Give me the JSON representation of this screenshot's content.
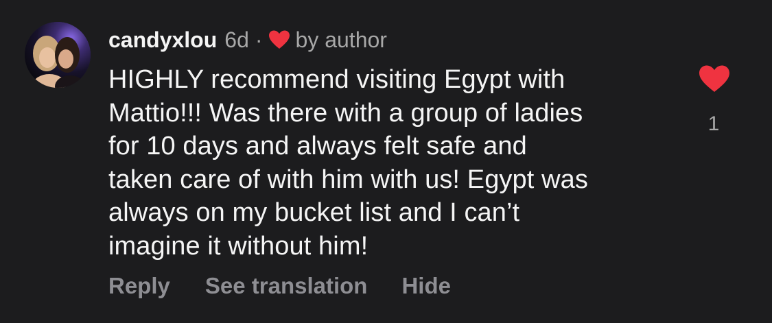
{
  "comment": {
    "username": "candyxlou",
    "timestamp": "6d",
    "separator": "·",
    "author_like_label": "by author",
    "text": "HIGHLY recommend visiting Egypt with\nMattio!!! Was there with a group of ladies\nfor 10 days and always felt safe and\ntaken care of with him with us! Egypt was\nalways on my bucket list and I can’t\nimagine it without him!",
    "like_count": "1",
    "heart_color": "#ef3340",
    "actions": {
      "reply": "Reply",
      "see_translation": "See translation",
      "hide": "Hide"
    }
  },
  "theme": {
    "background": "#1c1c1e",
    "primary_text": "#f5f5f5",
    "secondary_text": "#a8a8a8",
    "action_text": "#8e8e93"
  }
}
